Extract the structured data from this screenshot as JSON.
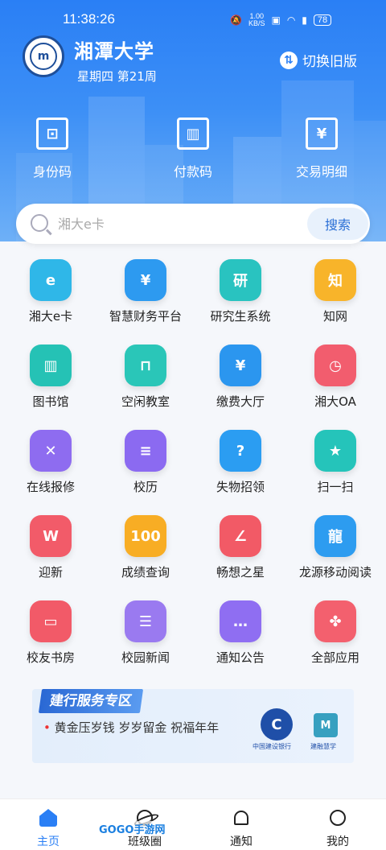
{
  "status_bar": {
    "time": "11:38:26",
    "net_speed_value": "1.00",
    "net_speed_unit": "KB/S",
    "battery": "78"
  },
  "header": {
    "university": "湘潭大学",
    "week_info": "星期四 第21周",
    "switch_label": "切换旧版",
    "quick_actions": [
      {
        "label": "身份码",
        "icon": "id-code-icon"
      },
      {
        "label": "付款码",
        "icon": "barcode-icon"
      },
      {
        "label": "交易明细",
        "icon": "receipt-icon"
      }
    ]
  },
  "search": {
    "placeholder": "湘大e卡",
    "button_label": "搜索"
  },
  "apps": [
    {
      "label": "湘大e卡",
      "glyph": "e",
      "color": "#2fb7e8"
    },
    {
      "label": "智慧财务平台",
      "glyph": "¥",
      "color": "#2d9af0"
    },
    {
      "label": "研究生系统",
      "glyph": "研",
      "color": "#29c3c0"
    },
    {
      "label": "知网",
      "glyph": "知",
      "color": "#f8b42a"
    },
    {
      "label": "图书馆",
      "glyph": "▥",
      "color": "#25c2b5"
    },
    {
      "label": "空闲教室",
      "glyph": "⊓",
      "color": "#2ac6b8"
    },
    {
      "label": "缴费大厅",
      "glyph": "¥",
      "color": "#2b96ef"
    },
    {
      "label": "湘大OA",
      "glyph": "◷",
      "color": "#f25d6e"
    },
    {
      "label": "在线报修",
      "glyph": "✕",
      "color": "#8e6cf0"
    },
    {
      "label": "校历",
      "glyph": "≡",
      "color": "#8b6af1"
    },
    {
      "label": "失物招领",
      "glyph": "?",
      "color": "#2b9df2"
    },
    {
      "label": "扫一扫",
      "glyph": "★",
      "color": "#25c4ba"
    },
    {
      "label": "迎新",
      "glyph": "W",
      "color": "#f25b69"
    },
    {
      "label": "成绩查询",
      "glyph": "100",
      "color": "#f8ad24"
    },
    {
      "label": "畅想之星",
      "glyph": "∠",
      "color": "#f25a66"
    },
    {
      "label": "龙源移动阅读",
      "glyph": "龍",
      "color": "#2d9cf0"
    },
    {
      "label": "校友书房",
      "glyph": "▭",
      "color": "#f25a68"
    },
    {
      "label": "校园新闻",
      "glyph": "☰",
      "color": "#9a7af0"
    },
    {
      "label": "通知公告",
      "glyph": "…",
      "color": "#8f6ef2"
    },
    {
      "label": "全部应用",
      "glyph": "✤",
      "color": "#f3606e"
    }
  ],
  "banner": {
    "title": "建行服务专区",
    "text": "黄金压岁钱 岁岁留金 祝福年年",
    "bank_name": "中国建设银行",
    "partner_name": "建融慧学"
  },
  "tabs": [
    {
      "label": "主页",
      "active": true
    },
    {
      "label": "班级圈",
      "active": false
    },
    {
      "label": "通知",
      "active": false
    },
    {
      "label": "我的",
      "active": false
    }
  ],
  "watermark": "GOGO手游网"
}
